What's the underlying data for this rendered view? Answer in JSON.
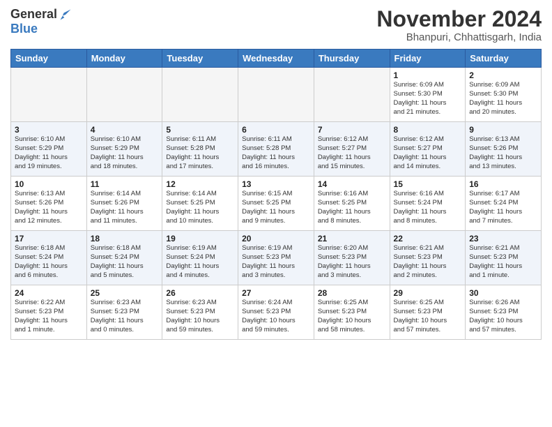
{
  "logo": {
    "general": "General",
    "blue": "Blue"
  },
  "title": "November 2024",
  "subtitle": "Bhanpuri, Chhattisgarh, India",
  "days_of_week": [
    "Sunday",
    "Monday",
    "Tuesday",
    "Wednesday",
    "Thursday",
    "Friday",
    "Saturday"
  ],
  "weeks": [
    [
      {
        "day": "",
        "info": "",
        "empty": true
      },
      {
        "day": "",
        "info": "",
        "empty": true
      },
      {
        "day": "",
        "info": "",
        "empty": true
      },
      {
        "day": "",
        "info": "",
        "empty": true
      },
      {
        "day": "",
        "info": "",
        "empty": true
      },
      {
        "day": "1",
        "info": "Sunrise: 6:09 AM\nSunset: 5:30 PM\nDaylight: 11 hours\nand 21 minutes."
      },
      {
        "day": "2",
        "info": "Sunrise: 6:09 AM\nSunset: 5:30 PM\nDaylight: 11 hours\nand 20 minutes."
      }
    ],
    [
      {
        "day": "3",
        "info": "Sunrise: 6:10 AM\nSunset: 5:29 PM\nDaylight: 11 hours\nand 19 minutes."
      },
      {
        "day": "4",
        "info": "Sunrise: 6:10 AM\nSunset: 5:29 PM\nDaylight: 11 hours\nand 18 minutes."
      },
      {
        "day": "5",
        "info": "Sunrise: 6:11 AM\nSunset: 5:28 PM\nDaylight: 11 hours\nand 17 minutes."
      },
      {
        "day": "6",
        "info": "Sunrise: 6:11 AM\nSunset: 5:28 PM\nDaylight: 11 hours\nand 16 minutes."
      },
      {
        "day": "7",
        "info": "Sunrise: 6:12 AM\nSunset: 5:27 PM\nDaylight: 11 hours\nand 15 minutes."
      },
      {
        "day": "8",
        "info": "Sunrise: 6:12 AM\nSunset: 5:27 PM\nDaylight: 11 hours\nand 14 minutes."
      },
      {
        "day": "9",
        "info": "Sunrise: 6:13 AM\nSunset: 5:26 PM\nDaylight: 11 hours\nand 13 minutes."
      }
    ],
    [
      {
        "day": "10",
        "info": "Sunrise: 6:13 AM\nSunset: 5:26 PM\nDaylight: 11 hours\nand 12 minutes."
      },
      {
        "day": "11",
        "info": "Sunrise: 6:14 AM\nSunset: 5:26 PM\nDaylight: 11 hours\nand 11 minutes."
      },
      {
        "day": "12",
        "info": "Sunrise: 6:14 AM\nSunset: 5:25 PM\nDaylight: 11 hours\nand 10 minutes."
      },
      {
        "day": "13",
        "info": "Sunrise: 6:15 AM\nSunset: 5:25 PM\nDaylight: 11 hours\nand 9 minutes."
      },
      {
        "day": "14",
        "info": "Sunrise: 6:16 AM\nSunset: 5:25 PM\nDaylight: 11 hours\nand 8 minutes."
      },
      {
        "day": "15",
        "info": "Sunrise: 6:16 AM\nSunset: 5:24 PM\nDaylight: 11 hours\nand 8 minutes."
      },
      {
        "day": "16",
        "info": "Sunrise: 6:17 AM\nSunset: 5:24 PM\nDaylight: 11 hours\nand 7 minutes."
      }
    ],
    [
      {
        "day": "17",
        "info": "Sunrise: 6:18 AM\nSunset: 5:24 PM\nDaylight: 11 hours\nand 6 minutes."
      },
      {
        "day": "18",
        "info": "Sunrise: 6:18 AM\nSunset: 5:24 PM\nDaylight: 11 hours\nand 5 minutes."
      },
      {
        "day": "19",
        "info": "Sunrise: 6:19 AM\nSunset: 5:24 PM\nDaylight: 11 hours\nand 4 minutes."
      },
      {
        "day": "20",
        "info": "Sunrise: 6:19 AM\nSunset: 5:23 PM\nDaylight: 11 hours\nand 3 minutes."
      },
      {
        "day": "21",
        "info": "Sunrise: 6:20 AM\nSunset: 5:23 PM\nDaylight: 11 hours\nand 3 minutes."
      },
      {
        "day": "22",
        "info": "Sunrise: 6:21 AM\nSunset: 5:23 PM\nDaylight: 11 hours\nand 2 minutes."
      },
      {
        "day": "23",
        "info": "Sunrise: 6:21 AM\nSunset: 5:23 PM\nDaylight: 11 hours\nand 1 minute."
      }
    ],
    [
      {
        "day": "24",
        "info": "Sunrise: 6:22 AM\nSunset: 5:23 PM\nDaylight: 11 hours\nand 1 minute."
      },
      {
        "day": "25",
        "info": "Sunrise: 6:23 AM\nSunset: 5:23 PM\nDaylight: 11 hours\nand 0 minutes."
      },
      {
        "day": "26",
        "info": "Sunrise: 6:23 AM\nSunset: 5:23 PM\nDaylight: 10 hours\nand 59 minutes."
      },
      {
        "day": "27",
        "info": "Sunrise: 6:24 AM\nSunset: 5:23 PM\nDaylight: 10 hours\nand 59 minutes."
      },
      {
        "day": "28",
        "info": "Sunrise: 6:25 AM\nSunset: 5:23 PM\nDaylight: 10 hours\nand 58 minutes."
      },
      {
        "day": "29",
        "info": "Sunrise: 6:25 AM\nSunset: 5:23 PM\nDaylight: 10 hours\nand 57 minutes."
      },
      {
        "day": "30",
        "info": "Sunrise: 6:26 AM\nSunset: 5:23 PM\nDaylight: 10 hours\nand 57 minutes."
      }
    ]
  ]
}
